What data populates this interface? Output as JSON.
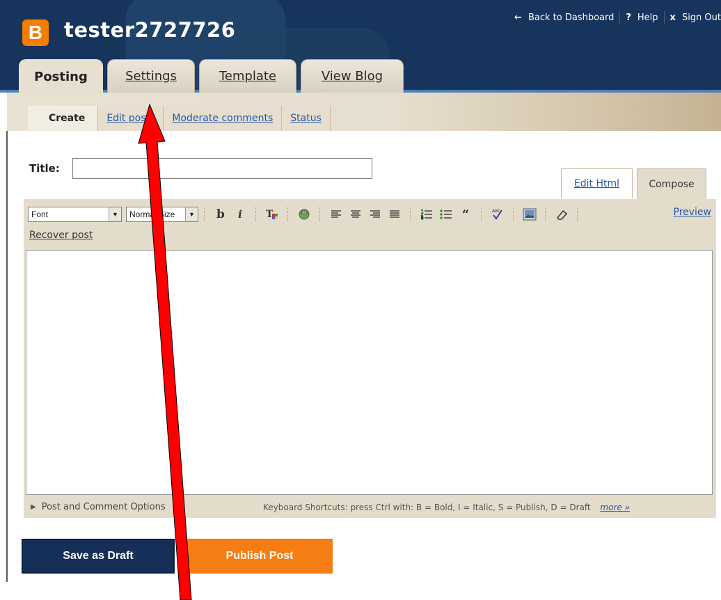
{
  "header": {
    "logo_letter": "B",
    "blog_name": "tester2727726",
    "links": [
      {
        "icon": "back-arrow-icon",
        "glyph": "←",
        "label": "Back to Dashboard"
      },
      {
        "icon": "help-icon",
        "glyph": "?",
        "label": "Help"
      },
      {
        "icon": "close-icon",
        "glyph": "x",
        "label": "Sign Out"
      }
    ]
  },
  "tabs": [
    {
      "label": "Posting",
      "active": true
    },
    {
      "label": "Settings",
      "active": false
    },
    {
      "label": "Template",
      "active": false
    },
    {
      "label": "View Blog",
      "active": false
    }
  ],
  "subtabs": [
    {
      "label": "Create",
      "active": true
    },
    {
      "label": "Edit posts",
      "active": false
    },
    {
      "label": "Moderate comments",
      "active": false
    },
    {
      "label": "Status",
      "active": false
    }
  ],
  "form": {
    "title_label": "Title:",
    "title_value": ""
  },
  "editor": {
    "mode_tabs": {
      "edit_html": "Edit Html",
      "compose": "Compose"
    },
    "font_select": "Font",
    "size_select": "Normal Size",
    "preview": "Preview",
    "recover_post": "Recover post",
    "post_options": "Post and Comment Options",
    "shortcuts": "Keyboard Shortcuts: press Ctrl with: B = Bold, I = Italic, S = Publish, D = Draft",
    "more": "more »"
  },
  "buttons": {
    "save_draft": "Save as Draft",
    "publish": "Publish Post"
  },
  "colors": {
    "header_bg": "#17345c",
    "accent_orange": "#f57d00",
    "annotation_arrow": "#ff0000"
  }
}
